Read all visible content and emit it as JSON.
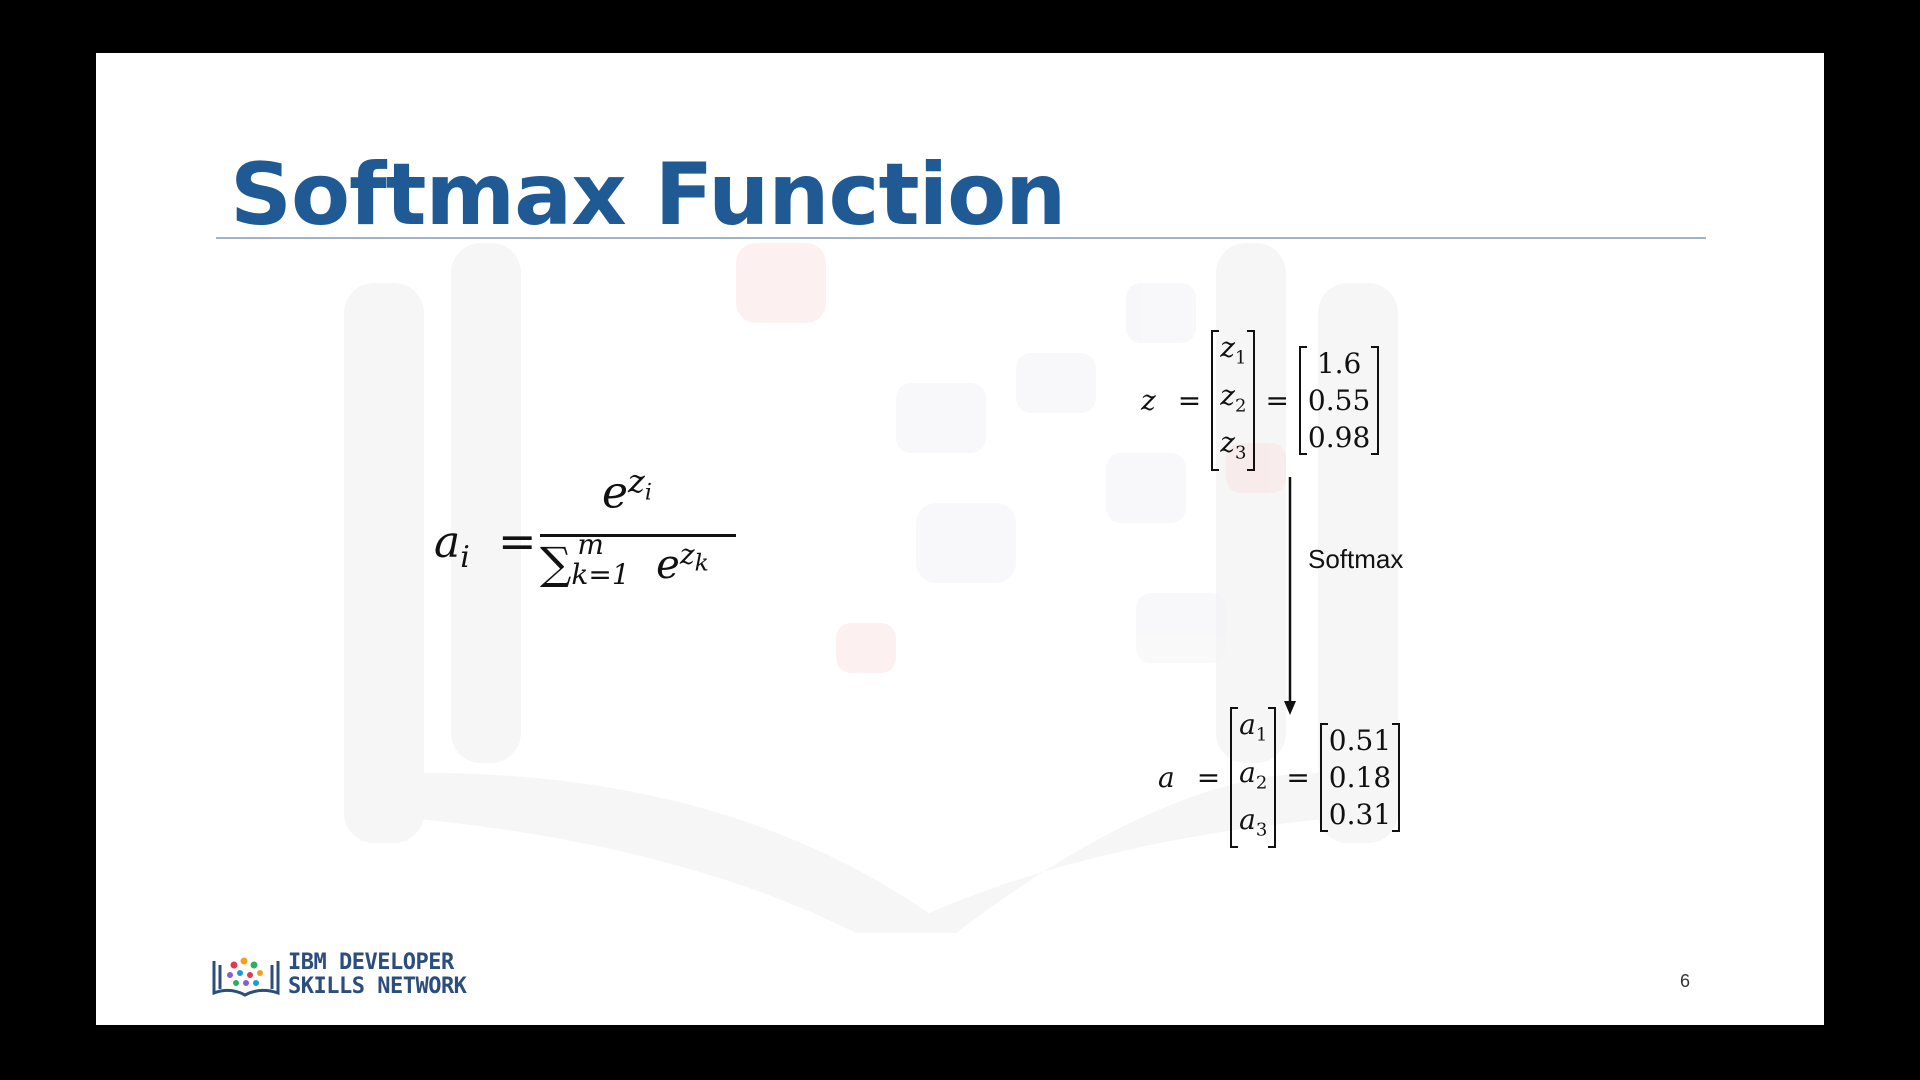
{
  "slide": {
    "title": "Softmax Function",
    "page_number": "6"
  },
  "formula": {
    "lhs": "a",
    "lhs_sub": "i",
    "equals": "=",
    "numerator_base": "e",
    "numerator_exp": "z",
    "numerator_exp_sub": "i",
    "sum_symbol": "∑",
    "sum_upper": "m",
    "sum_lower": "k=1",
    "denominator_base": "e",
    "denominator_exp": "z",
    "denominator_exp_sub": "k"
  },
  "input_vector": {
    "label": "z",
    "symbols": [
      {
        "base": "z",
        "sub": "1"
      },
      {
        "base": "z",
        "sub": "2"
      },
      {
        "base": "z",
        "sub": "3"
      }
    ],
    "values": [
      "1.6",
      "0.55",
      "0.98"
    ]
  },
  "arrow_label": "Softmax",
  "output_vector": {
    "label": "a",
    "symbols": [
      {
        "base": "a",
        "sub": "1"
      },
      {
        "base": "a",
        "sub": "2"
      },
      {
        "base": "a",
        "sub": "3"
      }
    ],
    "values": [
      "0.51",
      "0.18",
      "0.31"
    ]
  },
  "logo": {
    "line1": "IBM DEVELOPER",
    "line2": "SKILLS NETWORK"
  },
  "colors": {
    "title": "#1f5a95",
    "rule": "#9fb4c8",
    "logo_text": "#2b4e7d",
    "frame": "#000000"
  }
}
